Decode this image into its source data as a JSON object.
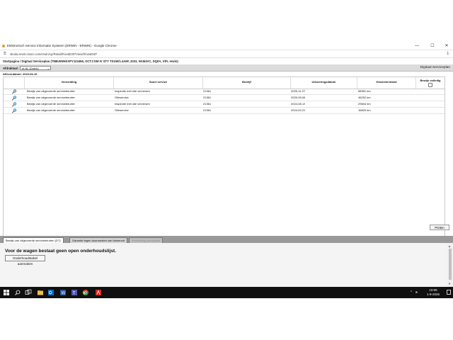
{
  "window": {
    "title": "Elektronisch Service Informatie Systeem (ERWIN - ERWIN) - Google Chrome",
    "controls": {
      "minimize": "—",
      "maximize": "☐",
      "close": "✕"
    }
  },
  "address_bar": {
    "url": "skoda.erwin-store.com/erwin/cp/Retail/FixedDSPView/ShowDSP"
  },
  "vehicle_info": "Startpagina / Digitaal Serviceplan (TMBJ6NNXXPY123456, OCT.COM IV STY TS150/1.4A6F, 2023, NA5I4VC, DQ0A, V8Y, erwin)",
  "toolbar": {
    "language_label": "Afdruktaal:",
    "language_value": "nl-NL (Dutch)",
    "page_title": "Digitaal Serviceplan"
  },
  "delivery_date": "Afleverdatum: 2023-06-16",
  "table": {
    "columns": {
      "vermelding": "Vermelding",
      "soort_service": "Soort service",
      "bedrijf": "Bedrijf",
      "uitvoeringsdatum": "Uitvoeringsdatum",
      "kilometerstand": "Kilometerstand",
      "bewijs_volledig": "Bewijs volledig"
    },
    "rows": [
      {
        "vermelding": "Bewijs van uitgevoerde servicebeurten",
        "soort_service": "Inspectie met olie verversen",
        "bedrijf": "21361",
        "uitvoeringsdatum": "2025-11-27",
        "kilometerstand": "58351 km"
      },
      {
        "vermelding": "Bewijs van uitgevoerde servicebeurten",
        "soort_service": "Olieservice",
        "bedrijf": "21361",
        "uitvoeringsdatum": "2025-05-08",
        "kilometerstand": "46292 km"
      },
      {
        "vermelding": "Bewijs van uitgevoerde servicebeurten",
        "soort_service": "Inspectie met olie verversen",
        "bedrijf": "21361",
        "uitvoeringsdatum": "2024-08-13",
        "kilometerstand": "29604 km"
      },
      {
        "vermelding": "Bewijs van uitgevoerde servicebeurten",
        "soort_service": "Olieservice",
        "bedrijf": "21361",
        "uitvoeringsdatum": "2024-02-23",
        "kilometerstand": "16825 km"
      }
    ]
  },
  "print_button": "Printen",
  "tabs": [
    {
      "label": "Bewijs van uitgevoerde servicebeurten (DT)",
      "state": "active"
    },
    {
      "label": "Garantie tegen doorroesten van binnenuit",
      "state": "normal"
    },
    {
      "label": "Vermelding werkplaats",
      "state": "disabled"
    }
  ],
  "bottom_panel": {
    "message": "Voor de wagen bestaat geen open onderhoudslijst.",
    "button": "Onderhoudstabel aanmaken"
  },
  "taskbar": {
    "icons": [
      "windows-start-icon",
      "search-icon",
      "task-view-icon",
      "file-explorer-icon",
      "outlook-icon",
      "word-icon",
      "teams-icon",
      "chrome-icon",
      "acrobat-icon"
    ],
    "tray": {
      "chevron": "^",
      "speaker": "🕪",
      "time": "10:05",
      "date": "1-9-2026"
    }
  },
  "colors": {
    "toolbar_bg": "#dcdcdc",
    "tab_strip_bg": "#9a9a9a",
    "taskbar_bg": "#101010",
    "chrome_accent": "#4285f4",
    "acrobat_accent": "#d9261c"
  }
}
